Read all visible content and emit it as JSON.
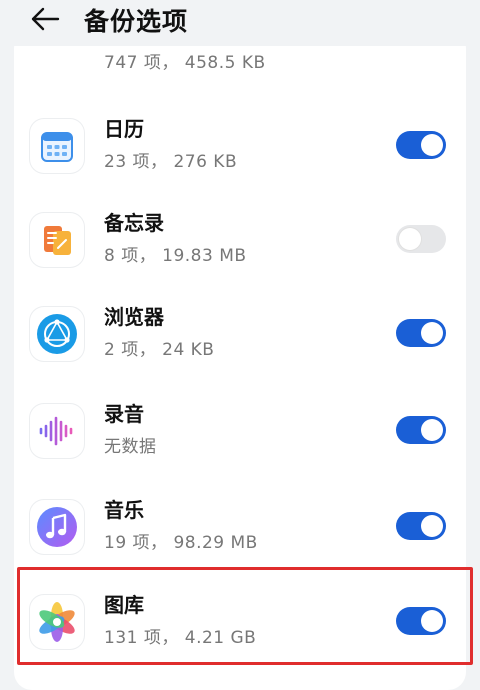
{
  "header": {
    "title": "备份选项"
  },
  "items": [
    {
      "name": "",
      "sub": "747 项， 458.5 KB",
      "enabled": true,
      "icon": "chat-icon"
    },
    {
      "name": "日历",
      "sub": "23 项， 276 KB",
      "enabled": true,
      "icon": "calendar-icon"
    },
    {
      "name": "备忘录",
      "sub": "8 项， 19.83 MB",
      "enabled": false,
      "icon": "notes-icon"
    },
    {
      "name": "浏览器",
      "sub": "2 项， 24 KB",
      "enabled": true,
      "icon": "browser-icon"
    },
    {
      "name": "录音",
      "sub": "无数据",
      "enabled": true,
      "icon": "recorder-icon"
    },
    {
      "name": "音乐",
      "sub": "19 项， 98.29 MB",
      "enabled": true,
      "icon": "music-icon"
    },
    {
      "name": "图库",
      "sub": "131 项， 4.21 GB",
      "enabled": true,
      "icon": "gallery-icon"
    }
  ],
  "colors": {
    "accent": "#1a5fd6",
    "highlight": "#e02d2d"
  }
}
